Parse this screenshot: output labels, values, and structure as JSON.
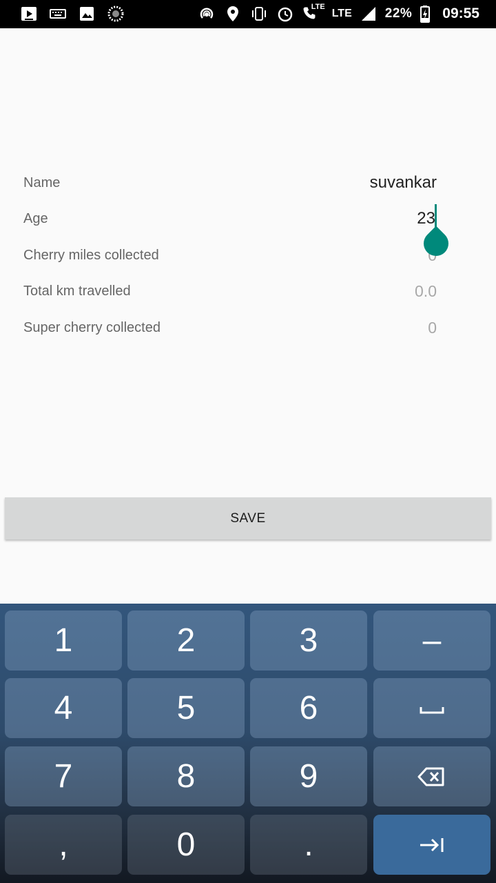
{
  "status_bar": {
    "left_icons": [
      "youtube-icon",
      "keyboard-icon",
      "image-icon",
      "loading-icon"
    ],
    "right_icons": [
      "hotspot-icon",
      "location-icon",
      "vibrate-icon",
      "alarm-icon",
      "volte-call-icon",
      "lte-icon",
      "signal-icon"
    ],
    "volte_label": "LTE",
    "lte_label": "LTE",
    "battery": "22%",
    "time": "09:55"
  },
  "form": {
    "fields": [
      {
        "label": "Name",
        "value": "suvankar"
      },
      {
        "label": "Age",
        "value": "23"
      },
      {
        "label": "Cherry miles collected",
        "value": "0"
      },
      {
        "label": "Total km travelled",
        "value": "0.0"
      },
      {
        "label": "Super cherry collected",
        "value": "0"
      }
    ]
  },
  "save_button": {
    "label": "SAVE"
  },
  "keyboard": {
    "keys": [
      "1",
      "2",
      "3",
      "–",
      "4",
      "5",
      "6",
      "␣",
      "7",
      "8",
      "9",
      "⌫",
      ",",
      "0",
      ".",
      "⇥"
    ]
  },
  "colors": {
    "accent": "#00897b",
    "keyboard_bg": "#2e4b6b",
    "button_bg": "#d6d7d7"
  }
}
